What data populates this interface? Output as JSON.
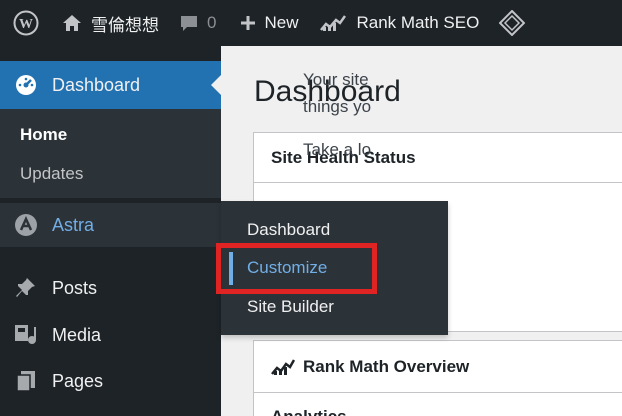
{
  "adminbar": {
    "site_name": "雪倫想想",
    "comments_count": "0",
    "new_label": "New",
    "rankmath_label": "Rank Math SEO"
  },
  "sidebar": {
    "dashboard_label": "Dashboard",
    "submenu": {
      "home": "Home",
      "updates": "Updates"
    },
    "astra_label": "Astra",
    "posts_label": "Posts",
    "media_label": "Media",
    "pages_label": "Pages"
  },
  "flyout": {
    "items": [
      "Dashboard",
      "Customize",
      "Site Builder"
    ]
  },
  "main": {
    "page_title": "Dashboard",
    "site_health": {
      "title": "Site Health Status",
      "line1": "Your site",
      "line2": "things yo",
      "line3": "Take a lo"
    },
    "rankmath": {
      "title": "Rank Math Overview",
      "sub": "Analytics"
    }
  },
  "colors": {
    "adminbar_bg": "#1d2327",
    "active_menu": "#2271b1",
    "highlight": "#e02323",
    "link_blue": "#72aee6"
  }
}
